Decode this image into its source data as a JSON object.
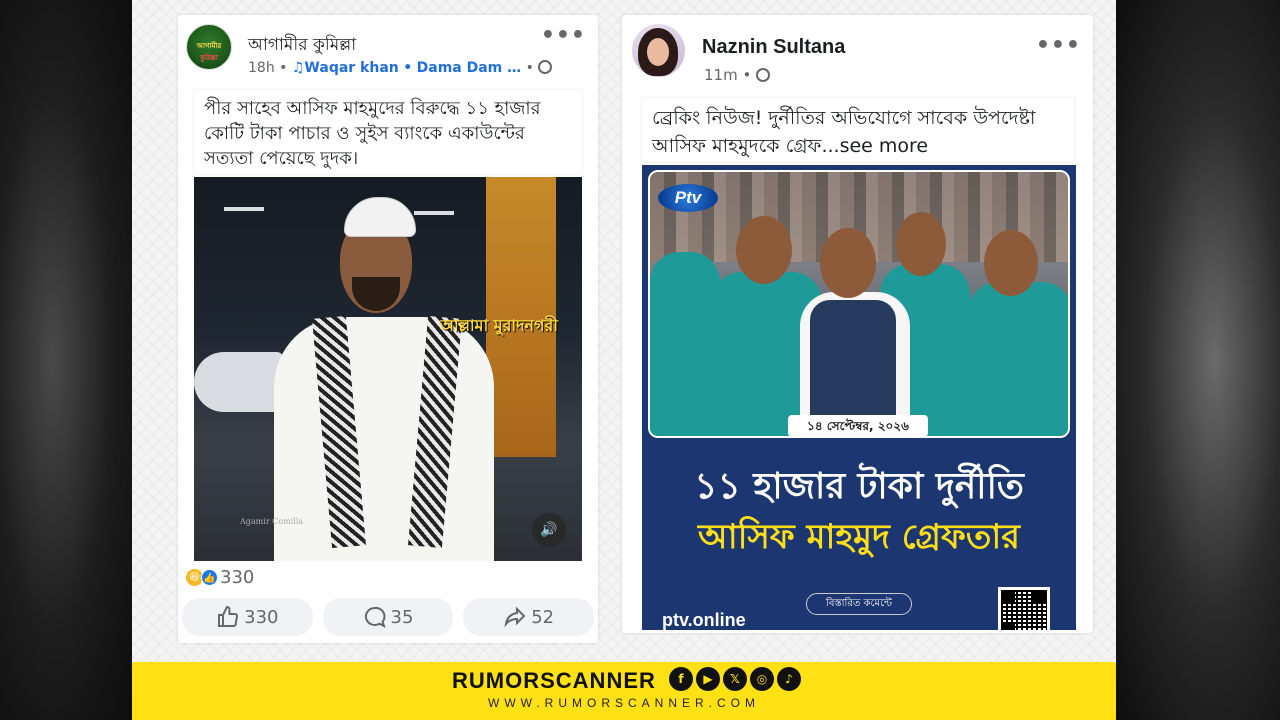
{
  "post1": {
    "page_name": "আগামীর কুমিল্লা",
    "avatar_text_top": "আগামীর",
    "avatar_text_bottom": "কুমিল্লা",
    "time": "18h",
    "music_note": "♫",
    "music_artist": "Waqar khan",
    "music_track": "Dama Dam …",
    "separator": "•",
    "text": "পীর সাহেব আসিফ মাহমুদের বিরুদ্ধে ১১ হাজার কোটি টাকা পাচার ও সুইস ব্যাংকে একাউন্টের সত্যতা পেয়েছে দুদক।",
    "photo_label": "আল্লামা মুরাদনগরী",
    "watermark": "Agamir Comilla",
    "reaction_count": "330",
    "like_count": "330",
    "comment_count": "35",
    "share_count": "52"
  },
  "post2": {
    "author": "Naznin Sultana",
    "time": "11m",
    "text": "ব্রেকিং নিউজ!  দুর্নীতির অভিযোগে সাবেক উপদেষ্টা আসিফ মাহমুদকে গ্রেফ",
    "see_more": "...see more",
    "card": {
      "logo": "Ptv",
      "date": "১৪ সেপ্টেম্বর, ২০২৬",
      "headline1": "১১ হাজার টাকা দুর্নীতি",
      "headline2": "আসিফ মাহমুদ গ্রেফতার",
      "comment_pill": "বিস্তারিত কমেন্টে",
      "site": "ptv.online"
    }
  },
  "footer": {
    "brand": "RUMORSCANNER",
    "url": "WWW.RUMORSCANNER.COM",
    "social_icons": [
      "facebook-icon",
      "youtube-icon",
      "x-icon",
      "instagram-icon",
      "tiktok-icon"
    ],
    "social_glyphs": [
      "f",
      "▶",
      "𝕏",
      "◎",
      "♪"
    ]
  },
  "colors": {
    "footer_bg": "#ffe114",
    "link_blue": "#216fdb",
    "news_bg": "#1b3670",
    "headline_yellow": "#ffde17"
  }
}
